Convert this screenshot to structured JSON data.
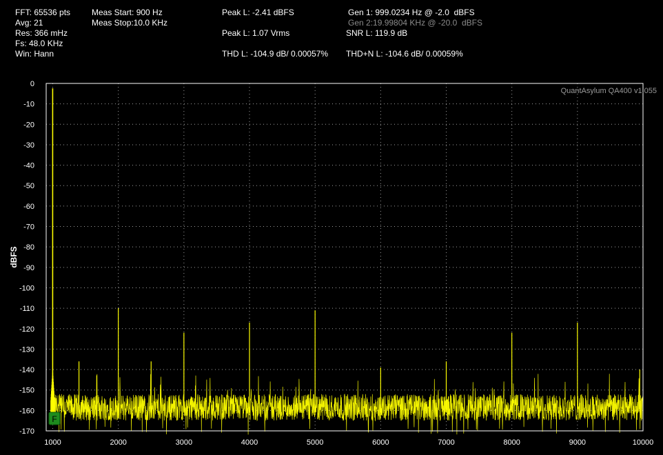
{
  "readouts": {
    "fft": "FFT: 65536 pts",
    "avg": "Avg: 21",
    "res": "Res: 366 mHz",
    "fs": "Fs: 48.0 KHz",
    "win": "Win: Hann",
    "meas_start": "Meas Start: 900 Hz",
    "meas_stop": "Meas Stop:10.0 KHz",
    "peak_dbfs": "Peak L: -2.41 dBFS",
    "peak_vrms": "Peak L: 1.07 Vrms",
    "thd": "THD L: -104.9 dB/ 0.00057%",
    "gen1": "Gen 1: 999.0234 Hz @ -2.0  dBFS",
    "gen2": "Gen 2:19.99804 KHz @ -20.0  dBFS",
    "snr": "SNR L: 119.9 dB",
    "thdn": "THD+N L: -104.6 dB/ 0.00059%"
  },
  "colors": {
    "trace": "#ffff00",
    "grid": "#c8c8c8",
    "background": "#000000",
    "marker": "#1e8c1e"
  },
  "marker": {
    "label": "F"
  },
  "chart_data": {
    "type": "line",
    "title": "",
    "watermark": "QuantAsylum QA400 v1.055",
    "xlabel": "",
    "ylabel": "dBFS",
    "xlim": [
      900,
      10000
    ],
    "ylim": [
      -170,
      0
    ],
    "x_ticks": [
      1000,
      2000,
      3000,
      4000,
      5000,
      6000,
      7000,
      8000,
      9000,
      10000
    ],
    "y_ticks": [
      0,
      -10,
      -20,
      -30,
      -40,
      -50,
      -60,
      -70,
      -80,
      -90,
      -100,
      -110,
      -120,
      -130,
      -140,
      -150,
      -160,
      -170
    ],
    "grid": true,
    "noise_floor_band": [
      -165,
      -152
    ],
    "series": [
      {
        "peaks": [
          {
            "x": 999,
            "y": -2.4
          },
          {
            "x": 1400,
            "y": -136
          },
          {
            "x": 2000,
            "y": -110
          },
          {
            "x": 2500,
            "y": -136
          },
          {
            "x": 3000,
            "y": -122
          },
          {
            "x": 4000,
            "y": -117
          },
          {
            "x": 5000,
            "y": -111
          },
          {
            "x": 6000,
            "y": -139
          },
          {
            "x": 7000,
            "y": -136
          },
          {
            "x": 8000,
            "y": -122
          },
          {
            "x": 9000,
            "y": -117
          },
          {
            "x": 9950,
            "y": -140
          }
        ]
      }
    ]
  }
}
